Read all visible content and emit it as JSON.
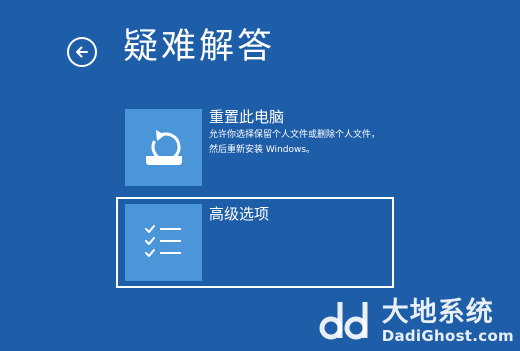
{
  "header": {
    "back_icon": "back-arrow-icon",
    "title": "疑难解答"
  },
  "options": [
    {
      "icon": "reset-pc-icon",
      "title": "重置此电脑",
      "description": "允许你选择保留个人文件或删除个人文件，然后重新安装 Windows。",
      "selected": false
    },
    {
      "icon": "checklist-icon",
      "title": "高级选项",
      "description": "",
      "selected": true
    }
  ],
  "watermark": {
    "logo": "dd-logo",
    "name_cn": "大地系统",
    "domain": "DadiGhost.com"
  },
  "colors": {
    "background": "#1e5da8",
    "tile": "#4b96d8",
    "text": "#ffffff"
  }
}
